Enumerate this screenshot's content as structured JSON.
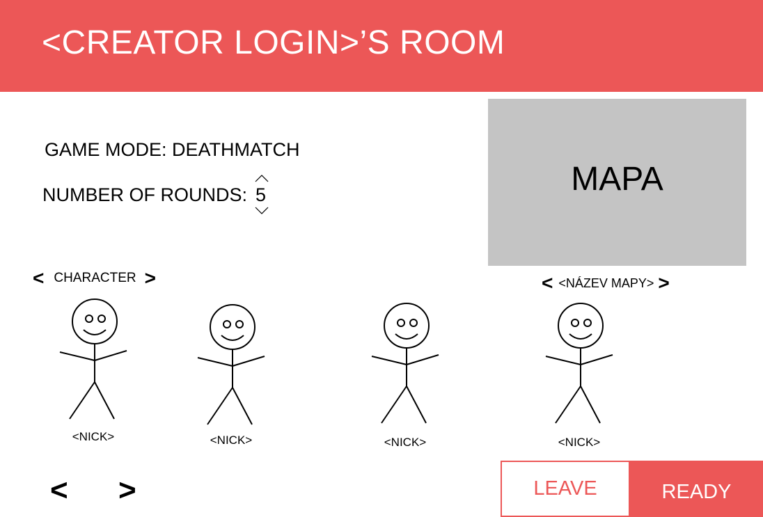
{
  "header": {
    "title": "<CREATOR LOGIN>’S ROOM"
  },
  "settings": {
    "game_mode": "GAME MODE: DEATHMATCH",
    "rounds_label": "NUMBER OF ROUNDS:",
    "rounds_value": "5"
  },
  "map": {
    "preview_label": "MAPA",
    "name": "<NÁZEV MAPY>",
    "prev": "<",
    "next": ">"
  },
  "character": {
    "label": "CHARACTER",
    "prev": "<",
    "next": ">"
  },
  "players": [
    {
      "nick": "<NICK>"
    },
    {
      "nick": "<NICK>"
    },
    {
      "nick": "<NICK>"
    },
    {
      "nick": "<NICK>"
    }
  ],
  "pager": {
    "prev": "<",
    "next": ">"
  },
  "actions": {
    "leave": "LEAVE",
    "ready": "READY"
  },
  "colors": {
    "accent": "#ec5757",
    "map_bg": "#c4c4c4"
  }
}
